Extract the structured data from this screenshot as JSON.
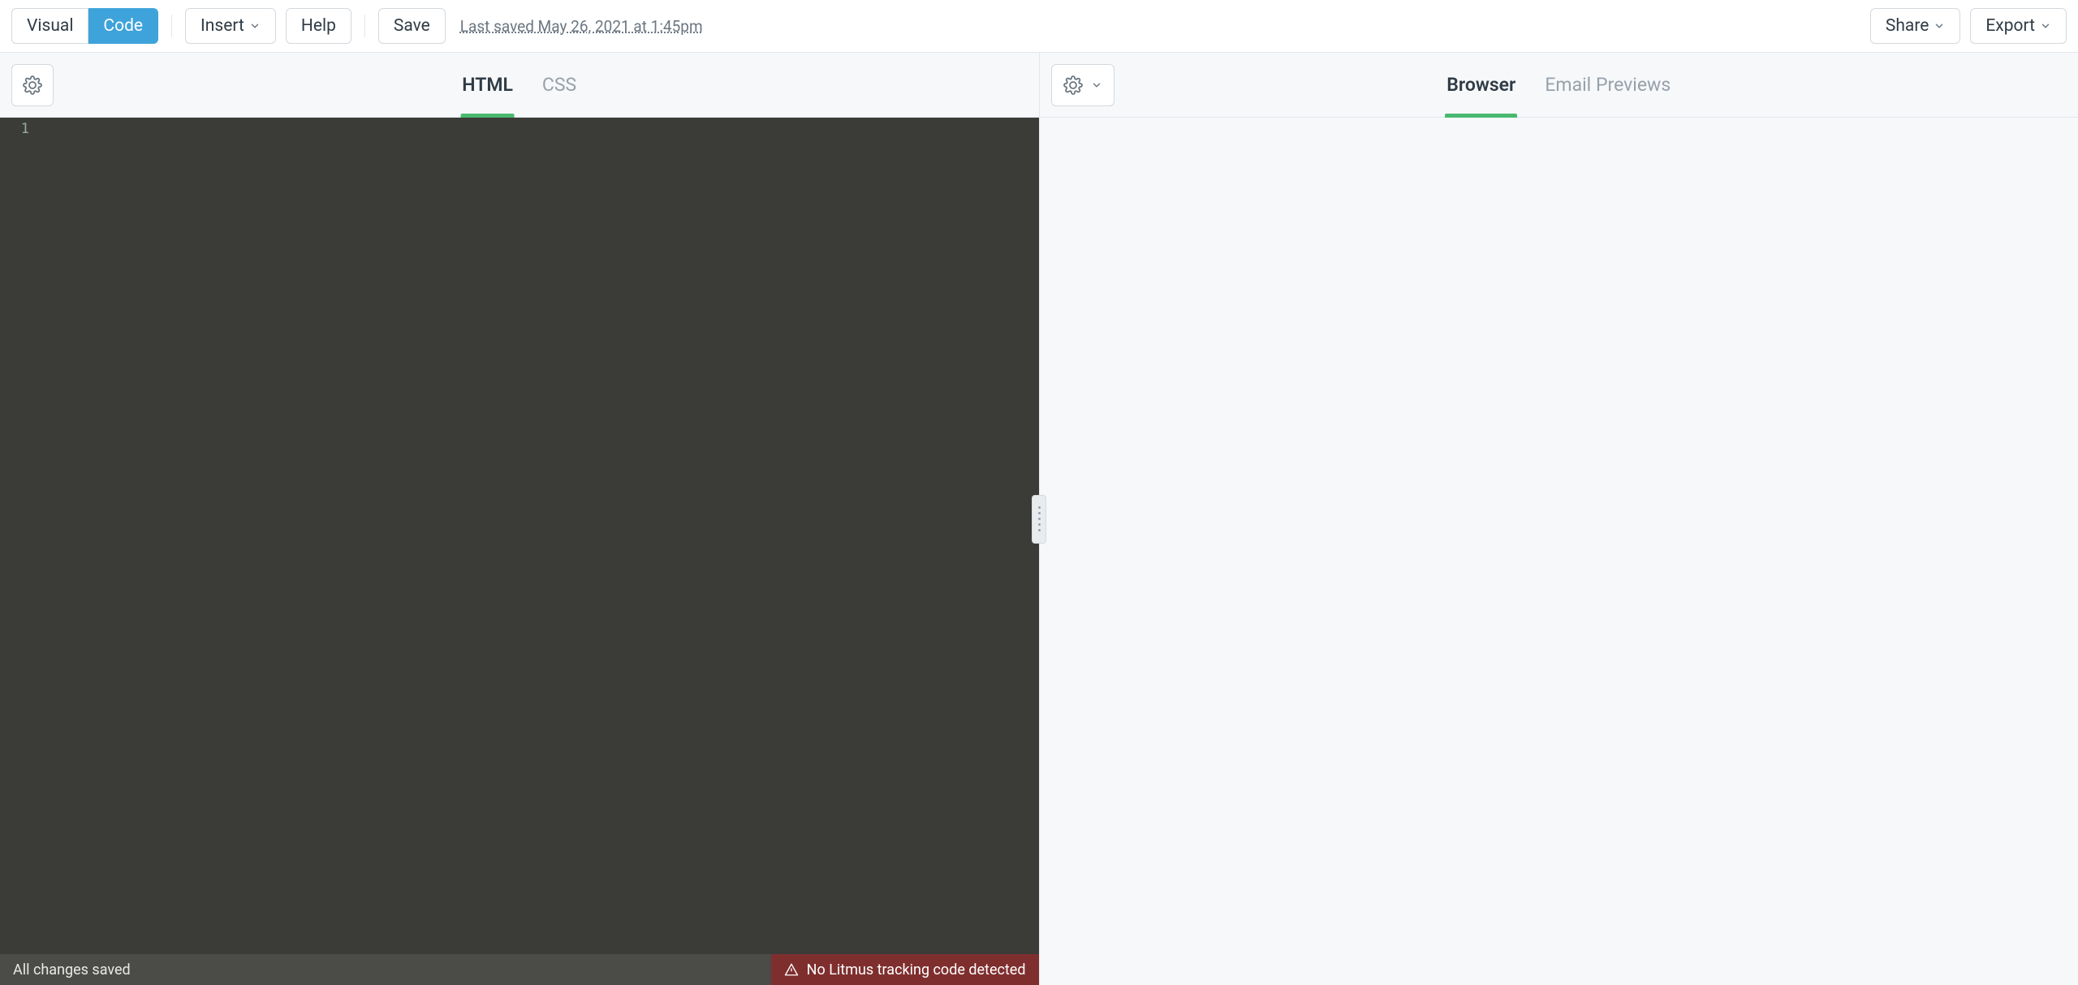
{
  "toolbar": {
    "view_toggle": {
      "visual": "Visual",
      "code": "Code",
      "active": "code"
    },
    "insert": "Insert",
    "help": "Help",
    "save": "Save",
    "last_saved": "Last saved May 26, 2021 at 1:45pm",
    "share": "Share",
    "export": "Export"
  },
  "left_panel": {
    "tabs": {
      "html": "HTML",
      "css": "CSS",
      "active": "html"
    },
    "editor": {
      "line_number": "1"
    },
    "footer": {
      "status": "All changes saved",
      "warning": "No Litmus tracking code detected"
    }
  },
  "right_panel": {
    "tabs": {
      "browser": "Browser",
      "email_previews": "Email Previews",
      "active": "browser"
    }
  }
}
